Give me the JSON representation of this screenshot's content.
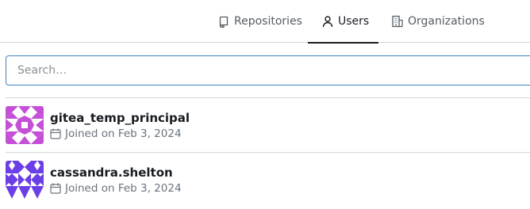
{
  "tabs": [
    {
      "label": "Repositories",
      "icon": "repo-icon",
      "active": false
    },
    {
      "label": "Users",
      "icon": "person-icon",
      "active": true
    },
    {
      "label": "Organizations",
      "icon": "organization-icon",
      "active": false
    }
  ],
  "search": {
    "placeholder": "Search…",
    "value": ""
  },
  "users": [
    {
      "name": "gitea_temp_principal",
      "joined": "Joined on Feb 3, 2024",
      "avatar_color": "#c550d8",
      "avatar_icon": "identicon"
    },
    {
      "name": "cassandra.shelton",
      "joined": "Joined on Feb 3, 2024",
      "avatar_color": "#6b3fe6",
      "avatar_icon": "identicon"
    }
  ],
  "colors": {
    "accent": "#4183c4",
    "text": "#181c21",
    "muted": "#6a737d",
    "border": "#d0d7de"
  }
}
